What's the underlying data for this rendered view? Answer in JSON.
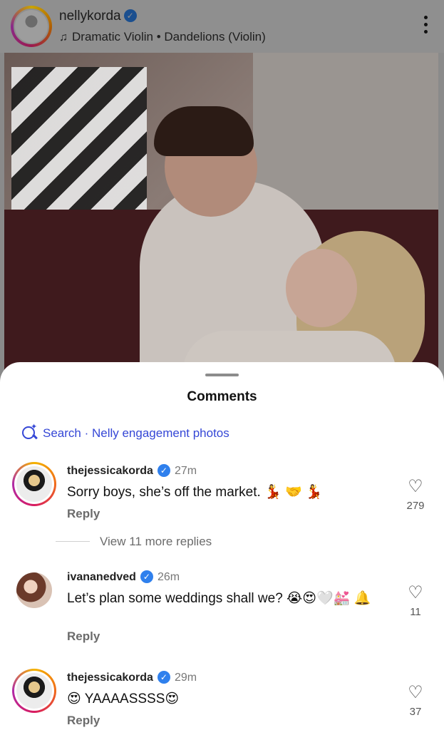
{
  "post": {
    "username": "nellykorda",
    "audio": "Dramatic Violin • Dandelions (Violin)"
  },
  "sheet": {
    "title": "Comments",
    "search_label": "Search · Nelly engagement photos"
  },
  "comments": [
    {
      "user": "thejessicakorda",
      "time": "27m",
      "text": "Sorry boys, she’s off the market. 💃 🤝 💃",
      "reply": "Reply",
      "likes": "279",
      "view_more": "View 11 more replies"
    },
    {
      "user": "ivananedved",
      "time": "26m",
      "text": "Let’s plan some weddings shall we? 😭😍🤍💒 🔔",
      "reply": "Reply",
      "likes": "11"
    },
    {
      "user": "thejessicakorda",
      "time": "29m",
      "text": "😍 YAAAASSSS😍",
      "reply": "Reply",
      "likes": "37"
    }
  ]
}
